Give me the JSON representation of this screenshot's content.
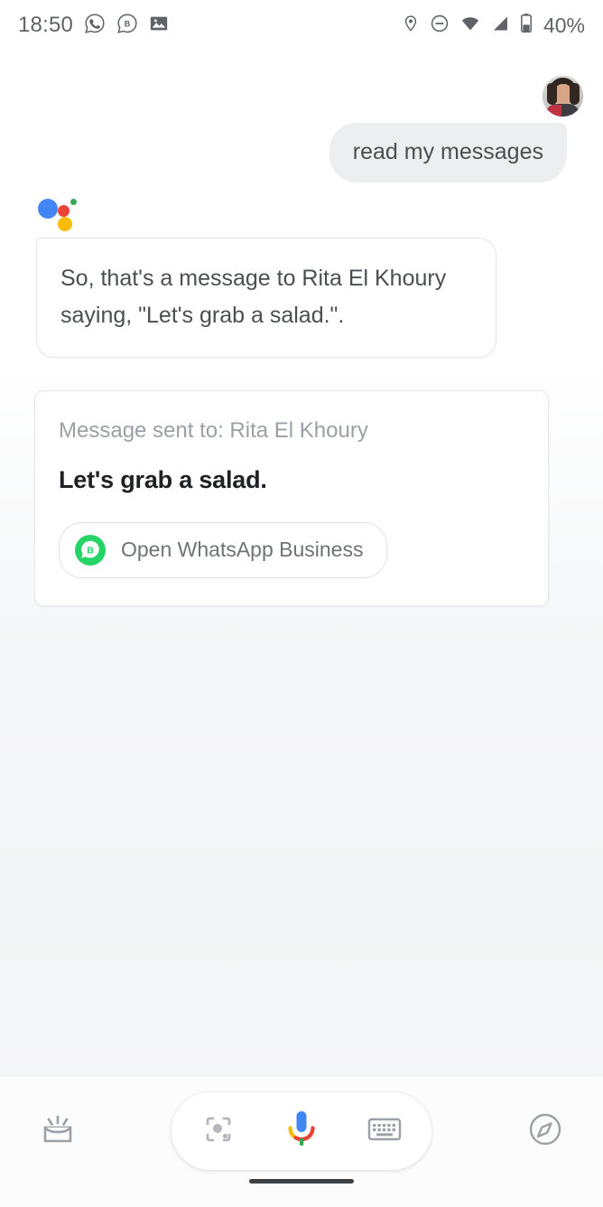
{
  "statusbar": {
    "time": "18:50",
    "battery_text": "40%",
    "left_icons": [
      "whatsapp-icon",
      "whatsapp-business-icon",
      "image-icon"
    ],
    "right_icons": [
      "location-icon",
      "dnd-icon",
      "wifi-icon",
      "signal-icon",
      "battery-icon"
    ]
  },
  "conversation": {
    "avatar_name": "user-avatar",
    "user_message": "read my messages",
    "assistant_logo": "google-assistant-logo",
    "assistant_message": "So, that's a message to Rita El Khoury saying, \"Let's grab a salad.\".",
    "card": {
      "subtitle": "Message sent to: Rita El Khoury",
      "body": "Let's grab a salad.",
      "action_label": "Open WhatsApp Business",
      "action_icon": "whatsapp-business-icon"
    }
  },
  "bottombar": {
    "snapshot_icon": "snapshot-icon",
    "lens_icon": "google-lens-icon",
    "mic_icon": "google-mic-icon",
    "keyboard_icon": "keyboard-icon",
    "explore_icon": "explore-compass-icon"
  },
  "colors": {
    "google_blue": "#4285f4",
    "google_red": "#ea4335",
    "google_yellow": "#fbbc05",
    "google_green": "#34a853",
    "whatsapp_green": "#25d366",
    "text_primary": "#202124",
    "text_secondary": "#5f6368",
    "text_muted": "#9aa0a6",
    "user_bubble_bg": "#eceeef"
  }
}
